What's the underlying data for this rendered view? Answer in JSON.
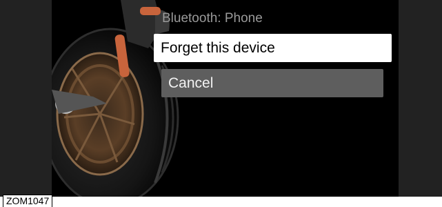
{
  "dialog": {
    "title": "Bluetooth: Phone",
    "options": [
      {
        "label": "Forget this device",
        "selected": true
      },
      {
        "label": "Cancel",
        "selected": false
      }
    ]
  },
  "figure_code": "ZOM1047",
  "colors": {
    "screen_bg": "#000000",
    "bezel": "#222222",
    "selected_bg": "#ffffff",
    "option_bg": "#5e5e5e",
    "title_text": "#9a9a9a",
    "accent": "#c8643c"
  },
  "background_image": "motorcycle-rear-wheel"
}
